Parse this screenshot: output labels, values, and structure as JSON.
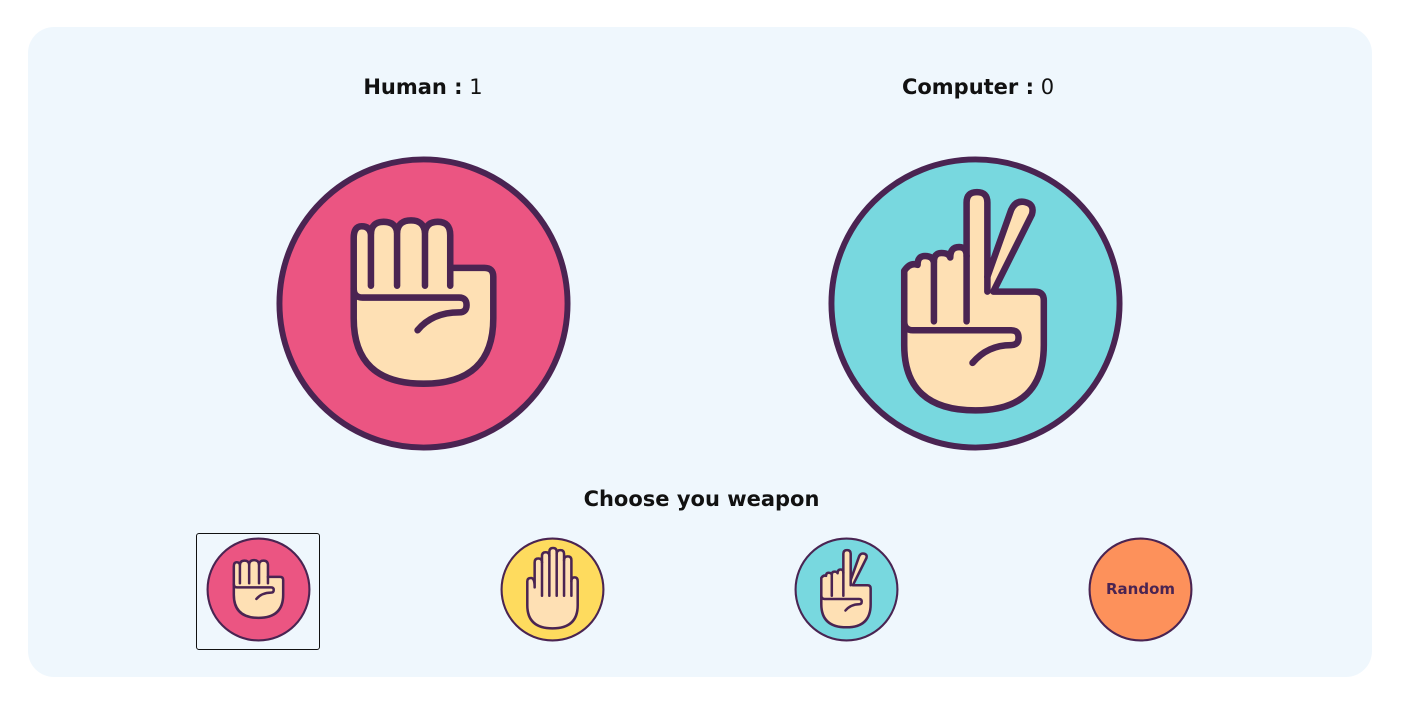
{
  "score": {
    "human_label": "Human :",
    "human_value": "1",
    "computer_label": "Computer :",
    "computer_value": "0"
  },
  "choices": {
    "human": "rock",
    "computer": "scissors",
    "selected": "rock"
  },
  "prompt": "Choose you weapon",
  "weapons": [
    {
      "id": "rock",
      "icon": "fist-icon",
      "color": "#eb5582"
    },
    {
      "id": "paper",
      "icon": "open-hand-icon",
      "color": "#fedb5e"
    },
    {
      "id": "scissors",
      "icon": "peace-hand-icon",
      "color": "#78d8df"
    },
    {
      "id": "random",
      "label": "Random",
      "color": "#fd915b"
    }
  ],
  "colors": {
    "outline": "#4a2452",
    "skin": "#fee0b4",
    "background": "#eff7fd"
  }
}
